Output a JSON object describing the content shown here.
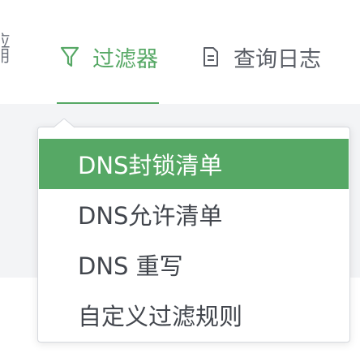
{
  "nav": {
    "cut_item": "应用",
    "filter": {
      "label": "过滤器",
      "icon": "filter-icon",
      "active": true
    },
    "query_log": {
      "label": "查询日志",
      "icon": "document-icon"
    }
  },
  "dropdown": {
    "items": [
      {
        "label": "DNS封锁清单",
        "selected": true
      },
      {
        "label": "DNS允许清单",
        "selected": false
      },
      {
        "label": "DNS 重写",
        "selected": false
      },
      {
        "label": "自定义过滤规则",
        "selected": false
      }
    ]
  },
  "colors": {
    "accent": "#56a865",
    "text": "#42464d",
    "muted": "#5a5e66",
    "background": "#f3f4f6"
  }
}
